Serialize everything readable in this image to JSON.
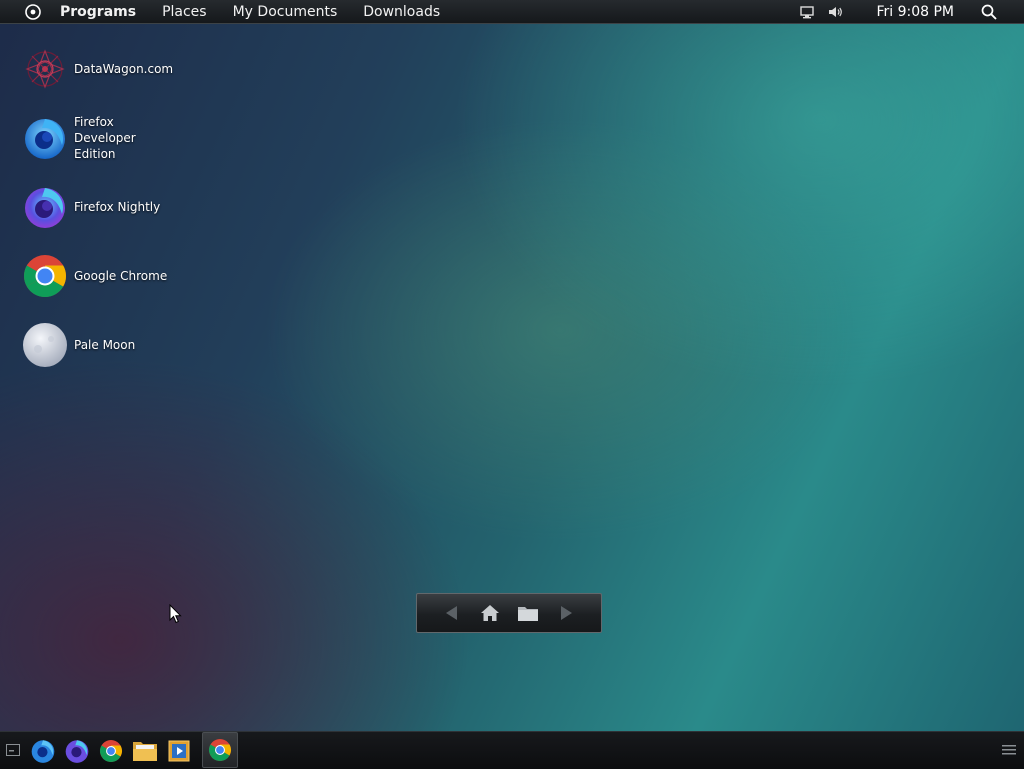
{
  "topbar": {
    "menu_items": [
      "Programs",
      "Places",
      "My Documents",
      "Downloads"
    ],
    "clock": "Fri 9:08 PM"
  },
  "desktop": {
    "icons": [
      {
        "label": "DataWagon.com",
        "icon": "datawagon-icon"
      },
      {
        "label": "Firefox Developer Edition",
        "icon": "firefox-developer-edition-icon"
      },
      {
        "label": "Firefox Nightly",
        "icon": "firefox-nightly-icon"
      },
      {
        "label": "Google Chrome",
        "icon": "google-chrome-icon"
      },
      {
        "label": "Pale Moon",
        "icon": "pale-moon-icon"
      }
    ]
  },
  "nav_widget": {
    "buttons": [
      "back-arrow-icon",
      "home-icon",
      "folder-icon",
      "forward-arrow-icon"
    ]
  },
  "taskbar": {
    "launchers": [
      "firefox-developer-edition-icon",
      "firefox-nightly-icon",
      "google-chrome-icon",
      "file-manager-icon",
      "media-player-icon"
    ],
    "running": [
      "google-chrome-icon"
    ]
  },
  "colors": {
    "panel": "#15181b",
    "accent_teal": "#2a8a8a"
  }
}
